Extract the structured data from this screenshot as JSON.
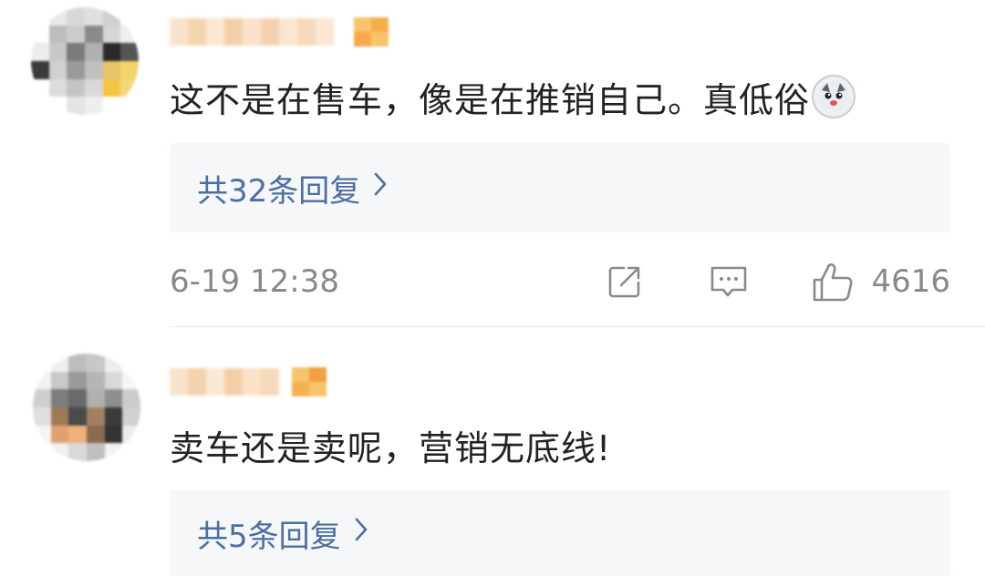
{
  "comments": [
    {
      "text": "这不是在售车，像是在推销自己。真低俗",
      "replies_label": "共32条回复",
      "timestamp": "6-19 12:38",
      "like_count": "4616"
    },
    {
      "text": "卖车还是卖呢，营销无底线!",
      "replies_label": "共5条回复"
    }
  ],
  "icons": {
    "reply_chevron": "chevron-right-icon",
    "edit": "edit-icon",
    "comment": "comment-icon",
    "like": "thumbs-up-icon",
    "emoji": "husky-emoji-icon"
  },
  "colors": {
    "reply_link": "#4a6fa1",
    "meta_text": "#888888",
    "reply_box": "#f6f7f8"
  }
}
